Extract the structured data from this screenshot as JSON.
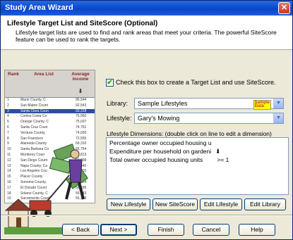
{
  "window": {
    "title": "Study Area Wizard",
    "close_glyph": "✕"
  },
  "header": {
    "title": "Lifestyle Target List and SiteScore (Optional)",
    "description": "Lifestyle target lists are used to find and rank areas that meet your criteria.  The powerful SiteScore feature can be used to rank the targets."
  },
  "illustration": {
    "columns": [
      "Rank",
      "Area List",
      "Average income"
    ],
    "sort_arrow": "⬇",
    "rows": [
      {
        "rank": "1",
        "area": "Marin County, C",
        "value": "95,544"
      },
      {
        "rank": "2",
        "area": "San Mateo Count",
        "value": "92,543"
      },
      {
        "rank": "3",
        "area": "Santa Clara Coun",
        "value": "93,318"
      },
      {
        "rank": "4",
        "area": "Contra Costa Co",
        "value": "75,950"
      },
      {
        "rank": "5",
        "area": "Orange County, C",
        "value": "75,037"
      },
      {
        "rank": "6",
        "area": "Santa Cruz Coun",
        "value": "74,761"
      },
      {
        "rank": "7",
        "area": "Ventura County,",
        "value": "74,030"
      },
      {
        "rank": "8",
        "area": "San Francisco",
        "value": "72,555"
      },
      {
        "rank": "9",
        "area": "Alameda County",
        "value": "69,310"
      },
      {
        "rank": "10",
        "area": "Santa Barbara Co",
        "value": "66,754"
      },
      {
        "rank": "11",
        "area": "Monterey Coun",
        "value": "64,813"
      },
      {
        "rank": "12",
        "area": "San Diego Count",
        "value": "63,998"
      },
      {
        "rank": "13",
        "area": "Napa County, Ca",
        "value": "63,640"
      },
      {
        "rank": "14",
        "area": "Los Angeles Cou",
        "value": "60,603"
      },
      {
        "rank": "15",
        "area": "Placer County",
        "value": "60,294"
      },
      {
        "rank": "16",
        "area": "Sonoma County,",
        "value": "59,964"
      },
      {
        "rank": "17",
        "area": "El Dorado Count",
        "value": "58,595"
      },
      {
        "rank": "18",
        "area": "Solano County, C",
        "value": "55,443"
      },
      {
        "rank": "19",
        "area": "Sacramento Count",
        "value": "55,189"
      }
    ]
  },
  "options": {
    "target_checkbox_label": "Check this box to create a Target List and use SiteScore.",
    "target_checkbox_checked": true,
    "checkmark": "✔",
    "library_label": "Library:",
    "library_value": "Sample Lifestyles",
    "library_badge_line1": "Sample",
    "library_badge_line2": "Data",
    "lifestyle_label": "Lifestyle:",
    "lifestyle_value": "Gary's Mowing",
    "dropdown_glyph": "▼",
    "dimensions_label": "Lifestyle Dimensions: (double click on line to edit a dimension)",
    "dimensions": [
      {
        "name": "Percentage owner occupied housing u",
        "condition": ""
      },
      {
        "name": "Expenditure per household on gardeni",
        "condition": "⬇"
      },
      {
        "name": "Total owner occupied housing units",
        "condition": ">= 1"
      }
    ]
  },
  "buttons": {
    "new_lifestyle": "New Lifestyle",
    "new_sitescore": "New SiteScore",
    "edit_lifestyle": "Edit Lifestyle",
    "edit_library": "Edit Library",
    "back": "< Back",
    "next": "Next >",
    "finish": "Finish",
    "cancel": "Cancel",
    "help": "Help"
  },
  "colors": {
    "title_bar": "#0d4fd3",
    "accent": "#003c74",
    "checkmark": "#21a121",
    "badge": "#ffff00"
  }
}
